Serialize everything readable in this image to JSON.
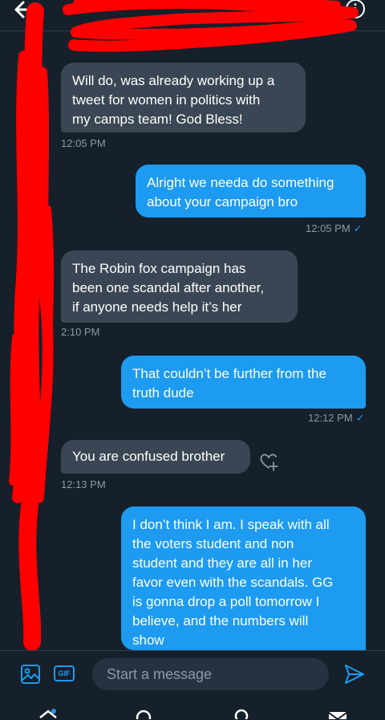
{
  "messages": [
    {
      "side": "received",
      "text": "Will do, was already working up a\ntweet for women in politics with\nmy camps team! God Bless!",
      "time": "12:05 PM"
    },
    {
      "side": "sent",
      "text": "Alright we needa do something\nabout your campaign bro",
      "time": "12:05 PM"
    },
    {
      "side": "received",
      "text": "The Robin fox campaign has\nbeen one scandal after another,\nif anyone needs help it’s her",
      "time": "2:10 PM"
    },
    {
      "side": "sent",
      "text": "That couldn’t be further from the\ntruth dude",
      "time": "12:12 PM"
    },
    {
      "side": "received",
      "text": "You are confused brother",
      "time": "12:13 PM"
    },
    {
      "side": "sent",
      "text": "I don’t think I am. I speak with all\nthe voters student and non\nstudent and they are all in her\nfavor even with the scandals. GG\nis gonna drop a poll tomorrow I\nbelieve, and the numbers will\nshow",
      "time": ""
    }
  ],
  "composer": {
    "placeholder": "Start a message",
    "gif_label": "GIF"
  },
  "icons": {
    "back": "arrow-left-icon",
    "info": "info-icon",
    "react": "heart-plus-icon",
    "media": "image-icon",
    "send": "send-icon"
  },
  "colors": {
    "background": "#15202b",
    "accent": "#1d9bf0",
    "received_bubble": "#3a4653",
    "redaction": "#ff0000"
  }
}
